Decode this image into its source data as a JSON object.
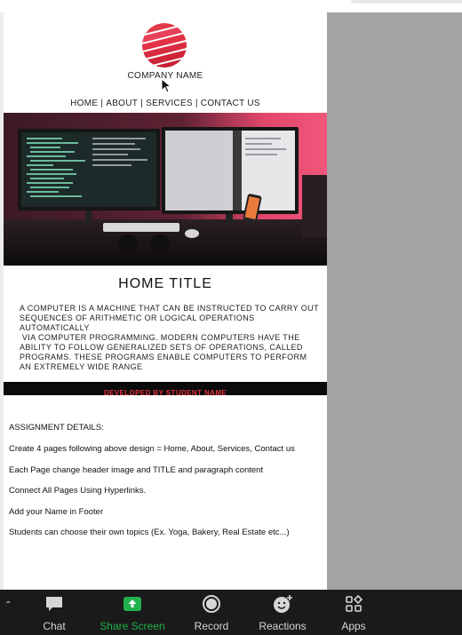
{
  "document": {
    "company_name": "COMPANY NAME",
    "nav": [
      "HOME",
      "ABOUT",
      "SERVICES",
      "CONTACT US"
    ],
    "nav_separator": "|",
    "home_title": "HOME TITLE",
    "paragraph_lines": [
      "A COMPUTER IS A MACHINE THAT CAN BE INSTRUCTED TO CARRY OUT",
      "SEQUENCES OF ARITHMETIC OR LOGICAL OPERATIONS AUTOMATICALLY",
      " VIA COMPUTER PROGRAMMING. MODERN COMPUTERS HAVE THE",
      "ABILITY TO FOLLOW GENERALIZED SETS OF OPERATIONS, CALLED",
      "PROGRAMS. THESE PROGRAMS ENABLE COMPUTERS TO PERFORM",
      "AN EXTREMELY WIDE RANGE"
    ],
    "footer": "DEVELOPED BY STUDENT NAME",
    "assignment_heading": "ASSIGNMENT DETAILS:",
    "assignment_lines": [
      "Create 4 pages following above design = Home, About, Services, Contact us",
      "Each Page change header image and TITLE and paragraph content",
      "Connect All Pages Using Hyperlinks.",
      "Add your Name in Footer",
      "Students can choose their own topics (Ex. Yoga, Bakery, Real Estate etc...)"
    ]
  },
  "toolbar": {
    "chat": "Chat",
    "share_screen": "Share Screen",
    "record": "Record",
    "reactions": "Reactions",
    "apps": "Apps"
  },
  "colors": {
    "accent_green": "#22b14c",
    "footer_text_red": "#e0323e",
    "toolbar_bg": "#1a1a1a"
  }
}
